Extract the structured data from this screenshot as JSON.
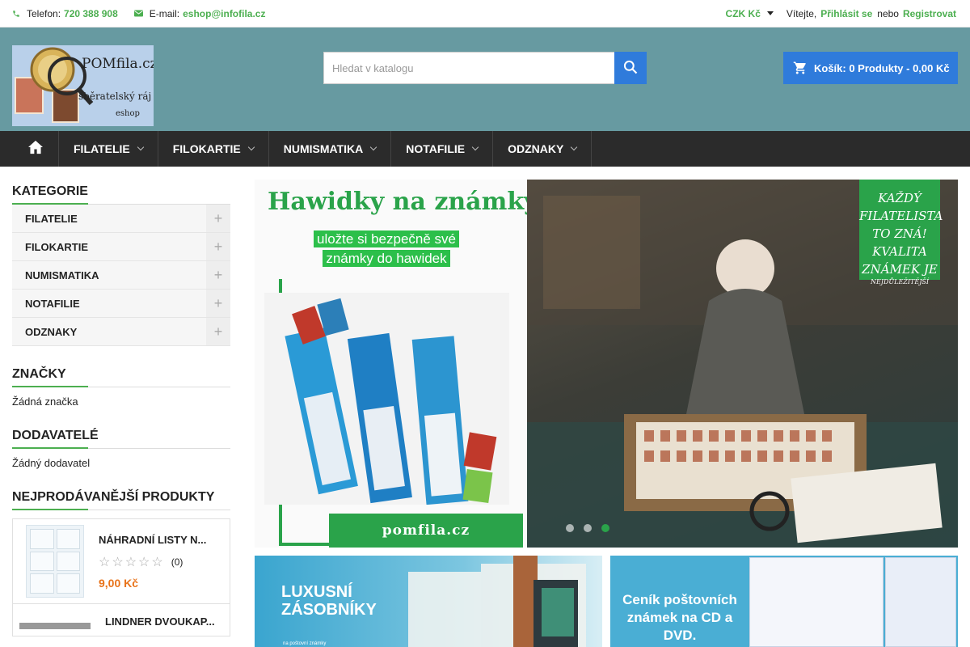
{
  "topbar": {
    "phone_label": "Telefon:",
    "phone": "720 388 908",
    "email_label": "E-mail:",
    "email": "eshop@infofila.cz",
    "currency": "CZK Kč",
    "welcome": "Vítejte,",
    "login": "Přihlásit se",
    "or": "nebo",
    "register": "Registrovat"
  },
  "header": {
    "logo_text": "POMfila.cz",
    "logo_tagline": "sběratelský ráj",
    "logo_sub": "eshop",
    "search_placeholder": "Hledat v katalogu",
    "cart": "Košík: 0 Produkty - 0,00 Kč"
  },
  "nav": {
    "items": [
      "FILATELIE",
      "FILOKARTIE",
      "NUMISMATIKA",
      "NOTAFILIE",
      "ODZNAKY"
    ]
  },
  "sidebar": {
    "categories_title": "KATEGORIE",
    "categories": [
      "FILATELIE",
      "FILOKARTIE",
      "NUMISMATIKA",
      "NOTAFILIE",
      "ODZNAKY"
    ],
    "brands_title": "ZNAČKY",
    "brands_text": "Žádná značka",
    "suppliers_title": "DODAVATELÉ",
    "suppliers_text": "Žádný dodavatel",
    "bestsellers_title": "NEJPRODÁVANĚJŠÍ PRODUKTY",
    "products": [
      {
        "name": "NÁHRADNÍ LISTY N...",
        "rating_count": "(0)",
        "price": "9,00 Kč"
      },
      {
        "name": "LINDNER DVOUKAP..."
      }
    ]
  },
  "hero": {
    "title": "Hawidky na známky",
    "subtitle_line1": "uložte si bezpečně své",
    "subtitle_line2": "známky do hawidek",
    "site": "pomfila.cz",
    "badge_lines": [
      "KAŽDÝ",
      "FILATELISTA",
      "TO ZNÁ!",
      "KVALITA",
      "ZNÁMEK JE"
    ],
    "badge_small": "NEJDŮLEŽITĚJŠÍ",
    "active_slide": 3,
    "slide_count": 3
  },
  "banners": {
    "b1_line1": "LUXUSNÍ",
    "b1_line2": "ZÁSOBNÍKY",
    "b1_small": "na poštovní známky",
    "b2_line1": "Ceník poštovních",
    "b2_line2": "známek na CD a DVD."
  },
  "colors": {
    "accent_green": "#4caf50",
    "header_bg": "#679aa1",
    "nav_bg": "#2b2b2b",
    "blue": "#2f7bdb",
    "price": "#e8731a"
  }
}
